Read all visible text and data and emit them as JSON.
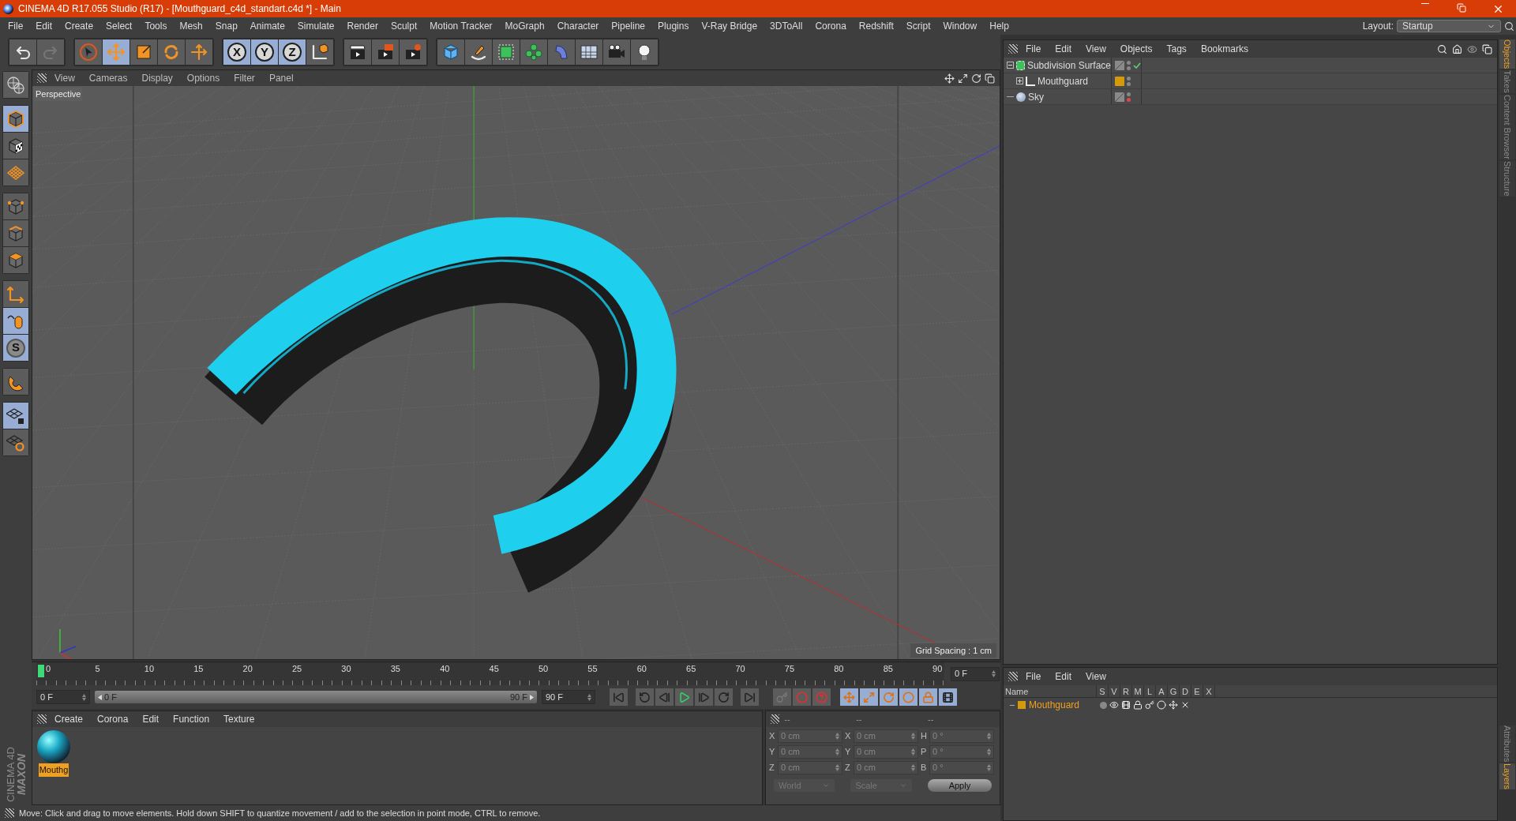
{
  "window": {
    "title": "CINEMA 4D R17.055 Studio (R17) - [Mouthguard_c4d_standart.c4d *] - Main"
  },
  "menu": [
    "File",
    "Edit",
    "Create",
    "Select",
    "Tools",
    "Mesh",
    "Snap",
    "Animate",
    "Simulate",
    "Render",
    "Sculpt",
    "Motion Tracker",
    "MoGraph",
    "Character",
    "Pipeline",
    "Plugins",
    "V-Ray Bridge",
    "3DToAll",
    "Corona",
    "Redshift",
    "Script",
    "Window",
    "Help"
  ],
  "layout": {
    "label": "Layout:",
    "value": "Startup"
  },
  "toolbar": [
    [
      {
        "kind": "undo",
        "selected": false
      },
      {
        "kind": "redo",
        "selected": false
      }
    ],
    [
      {
        "kind": "select",
        "selected": false
      },
      {
        "kind": "move",
        "selected": true
      },
      {
        "kind": "scale",
        "selected": false
      },
      {
        "kind": "rotate",
        "selected": false
      },
      {
        "kind": "transform",
        "selected": false
      }
    ],
    [
      {
        "kind": "axis",
        "label": "X",
        "selected": true
      },
      {
        "kind": "axis",
        "label": "Y",
        "selected": true
      },
      {
        "kind": "axis",
        "label": "Z",
        "selected": true
      },
      {
        "kind": "coords",
        "selected": false
      }
    ],
    [
      {
        "kind": "render-view",
        "selected": false
      },
      {
        "kind": "render",
        "selected": false
      },
      {
        "kind": "render-settings",
        "selected": false
      }
    ],
    [
      {
        "kind": "cube",
        "selected": false
      },
      {
        "kind": "pen",
        "selected": false
      },
      {
        "kind": "subdiv",
        "selected": false
      },
      {
        "kind": "cloner",
        "selected": false
      },
      {
        "kind": "bend",
        "selected": false
      },
      {
        "kind": "floor",
        "selected": false
      },
      {
        "kind": "camera",
        "selected": false
      },
      {
        "kind": "light",
        "selected": false
      }
    ]
  ],
  "left_tools": [
    [
      {
        "kind": "view",
        "selected": false
      }
    ],
    [
      {
        "kind": "model",
        "selected": true
      },
      {
        "kind": "texture",
        "selected": false
      },
      {
        "kind": "workplane",
        "selected": false
      }
    ],
    [
      {
        "kind": "points",
        "selected": false
      },
      {
        "kind": "edges",
        "selected": false
      },
      {
        "kind": "polygons",
        "selected": false
      }
    ],
    [
      {
        "kind": "axis-mode",
        "selected": false
      },
      {
        "kind": "tweak",
        "selected": true
      },
      {
        "kind": "solo",
        "label": "S",
        "selected": true
      }
    ],
    [
      {
        "kind": "snap",
        "selected": false
      }
    ],
    [
      {
        "kind": "wp-lock",
        "selected": true
      },
      {
        "kind": "wp-sync",
        "selected": false
      }
    ]
  ],
  "viewport": {
    "menu": [
      "View",
      "Cameras",
      "Display",
      "Options",
      "Filter",
      "Panel"
    ],
    "camera": "Perspective",
    "grid_spacing": "Grid Spacing : 1 cm"
  },
  "timeline": {
    "ticks": [
      "0",
      "5",
      "10",
      "15",
      "20",
      "25",
      "30",
      "35",
      "40",
      "45",
      "50",
      "55",
      "60",
      "65",
      "70",
      "75",
      "80",
      "85",
      "90"
    ],
    "playhead": {
      "level": 0
    },
    "range_bar": {
      "level": 1
    },
    "current": "0 F",
    "start": "0 F",
    "range_start": "0 F",
    "range_end": "90 F",
    "end": "90 F",
    "playback": [
      {
        "kind": "first"
      },
      {
        "kind": "prev-key"
      },
      {
        "kind": "prev-frame"
      },
      {
        "kind": "play"
      },
      {
        "kind": "next-frame"
      },
      {
        "kind": "next-key"
      },
      {
        "kind": "last"
      }
    ],
    "record": [
      {
        "kind": "keyframe"
      },
      {
        "kind": "record"
      },
      {
        "kind": "autokey"
      }
    ],
    "keys": [
      {
        "kind": "key-move",
        "selected": true
      },
      {
        "kind": "key-scale",
        "selected": true
      },
      {
        "kind": "key-rotate",
        "selected": true
      },
      {
        "kind": "key-param",
        "selected": true
      },
      {
        "kind": "key-pla",
        "selected": true
      },
      {
        "kind": "timeline",
        "selected": true
      }
    ]
  },
  "materials": {
    "menu": [
      "Create",
      "Corona",
      "Edit",
      "Function",
      "Texture"
    ],
    "items": [
      {
        "name": "Mouthg",
        "selected": true
      }
    ]
  },
  "coordinates": {
    "headers": [
      "--",
      "--",
      "--"
    ],
    "rows": [
      [
        {
          "axis": "X",
          "value": "0 cm"
        },
        {
          "axis": "X",
          "value": "0 cm"
        },
        {
          "axis": "H",
          "value": "0 °"
        }
      ],
      [
        {
          "axis": "Y",
          "value": "0 cm"
        },
        {
          "axis": "Y",
          "value": "0 cm"
        },
        {
          "axis": "P",
          "value": "0 °"
        }
      ],
      [
        {
          "axis": "Z",
          "value": "0 cm"
        },
        {
          "axis": "Z",
          "value": "0 cm"
        },
        {
          "axis": "B",
          "value": "0 °"
        }
      ]
    ],
    "mode": "World",
    "size": "Scale",
    "apply": "Apply"
  },
  "status_bar": "Move: Click and drag to move elements. Hold down SHIFT to quantize movement / add to the selection in point mode, CTRL to remove.",
  "logo": [
    "MAXON",
    "CINEMA 4D"
  ],
  "objects": {
    "menu": [
      "File",
      "Edit",
      "View",
      "Objects",
      "Tags",
      "Bookmarks"
    ],
    "tree": [
      {
        "name": "Subdivision Surface",
        "kind": "subdivision",
        "expanded": true,
        "checked": true,
        "render_hidden": false,
        "children": [
          {
            "name": "Mouthguard",
            "kind": "polygon",
            "expanded": false,
            "checked": false,
            "render_hidden": false,
            "color": "#d49a0a"
          }
        ]
      },
      {
        "name": "Sky",
        "kind": "sky",
        "checked": false,
        "render_hidden": true
      }
    ]
  },
  "layers": {
    "menu": [
      "File",
      "Edit",
      "View"
    ],
    "columns": [
      "Name",
      "S",
      "V",
      "R",
      "M",
      "L",
      "A",
      "G",
      "D",
      "E",
      "X"
    ],
    "rows": [
      {
        "name": "Mouthguard",
        "color": "#d49a0a"
      }
    ]
  },
  "side_tabs_top": [
    {
      "label": "Objects",
      "selected": true
    },
    {
      "label": "Takes",
      "selected": false
    },
    {
      "label": "Content Browser",
      "selected": false
    },
    {
      "label": "Structure",
      "selected": false
    }
  ],
  "side_tabs_bottom": [
    {
      "label": "Attributes",
      "selected": false
    },
    {
      "label": "Layers",
      "selected": true
    }
  ]
}
